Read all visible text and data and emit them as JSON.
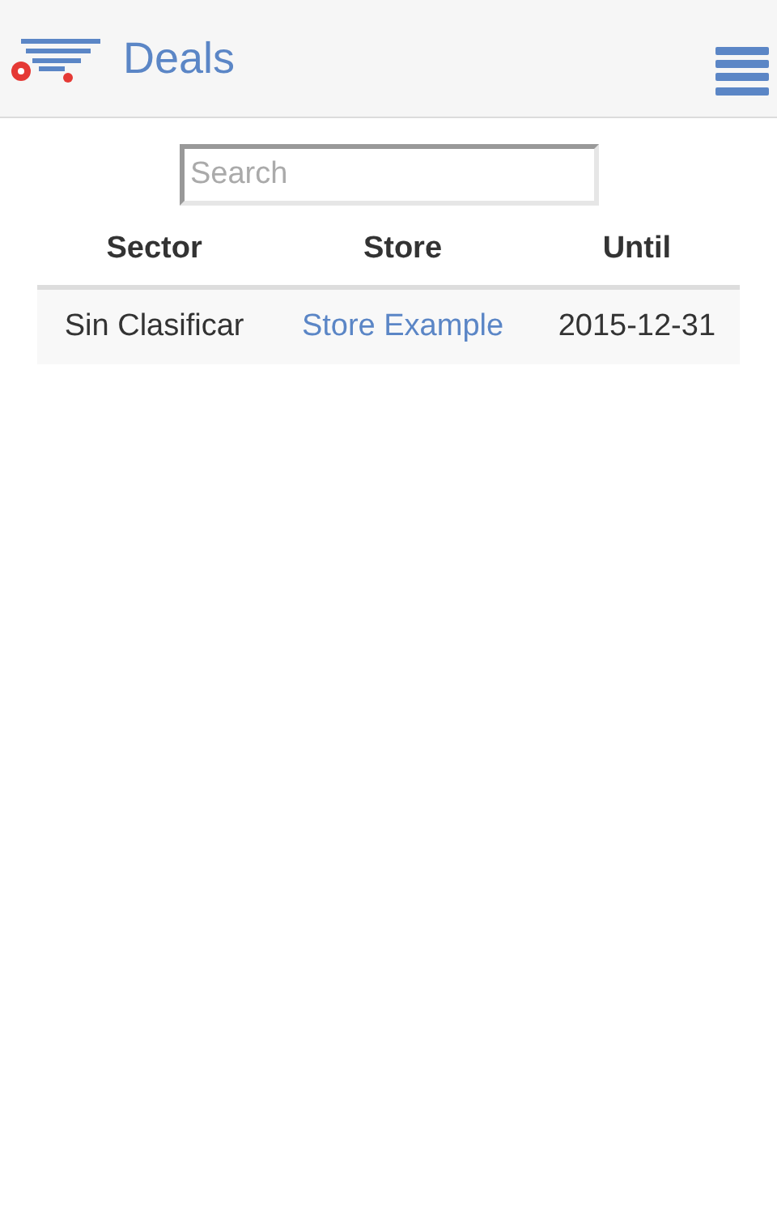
{
  "header": {
    "title": "Deals"
  },
  "search": {
    "placeholder": "Search"
  },
  "table": {
    "columns": [
      "Sector",
      "Store",
      "Until"
    ],
    "rows": [
      {
        "cells": [
          {
            "kind": "text",
            "text": "Sin Clasificar"
          },
          {
            "kind": "link",
            "text": "Store Example"
          },
          {
            "kind": "text",
            "text": "2015-12-31"
          }
        ]
      }
    ]
  }
}
